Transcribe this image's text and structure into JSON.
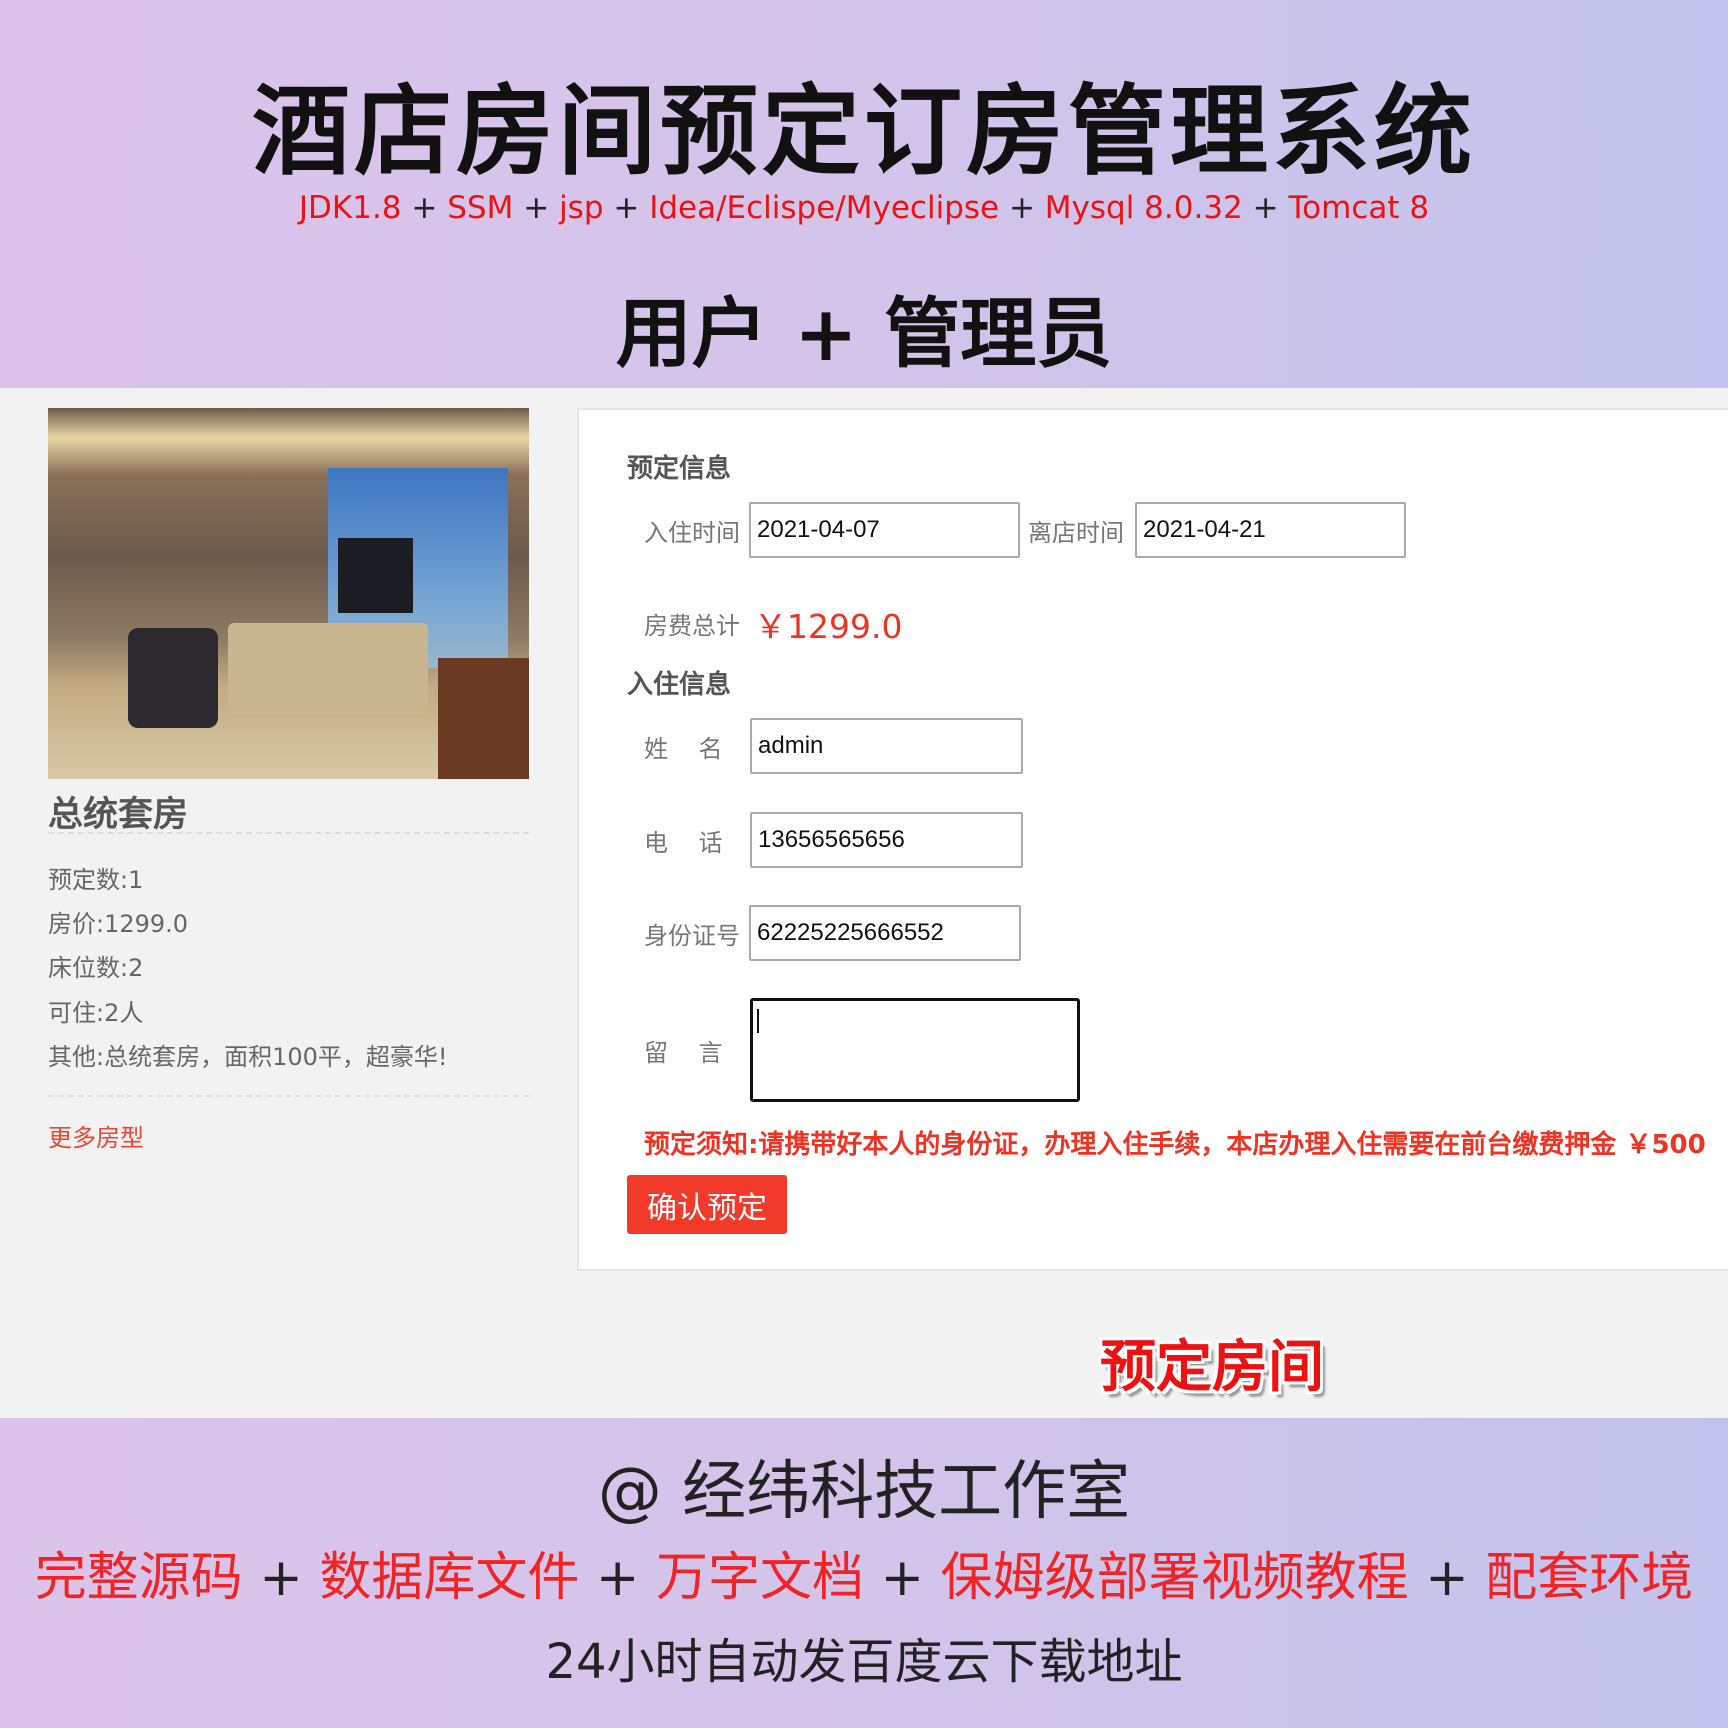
{
  "banner": {
    "title": "酒店房间预定订房管理系统",
    "tech": [
      "JDK1.8",
      "SSM",
      "jsp",
      "Idea/Eclispe/Myeclipse",
      "Mysql 8.0.32",
      "Tomcat 8"
    ],
    "plus": "+",
    "roles": "用户 + 管理员"
  },
  "room": {
    "name": "总统套房",
    "info": [
      "预定数:1",
      "房价:1299.0",
      "床位数:2",
      "可住:2人",
      "其他:总统套房，面积100平，超豪华!"
    ],
    "more_link": "更多房型"
  },
  "form": {
    "section_booking": "预定信息",
    "checkin_label": "入住时间",
    "checkin_value": "2021-04-07",
    "checkout_label": "离店时间",
    "checkout_value": "2021-04-21",
    "total_label": "房费总计",
    "total_value": "￥1299.0",
    "section_guest": "入住信息",
    "name_label": "姓    名",
    "name_value": "admin",
    "phone_label": "电    话",
    "phone_value": "13656565656",
    "id_label": "身份证号",
    "id_value": "62225225666552",
    "message_label": "留    言",
    "message_value": "",
    "notice": "预定须知:请携带好本人的身份证，办理入住手续，本店办理入住需要在前台缴费押金 ￥500",
    "submit_label": "确认预定"
  },
  "caption": "预定房间",
  "footer": {
    "studio": "@ 经纬科技工作室",
    "features": [
      "完整源码",
      "数据库文件",
      "万字文档",
      "保姆级部署视频教程",
      "配套环境"
    ],
    "download": "24小时自动发百度云下载地址"
  },
  "colors": {
    "accent": "#f23a2a",
    "highlight": "#ee1111"
  }
}
